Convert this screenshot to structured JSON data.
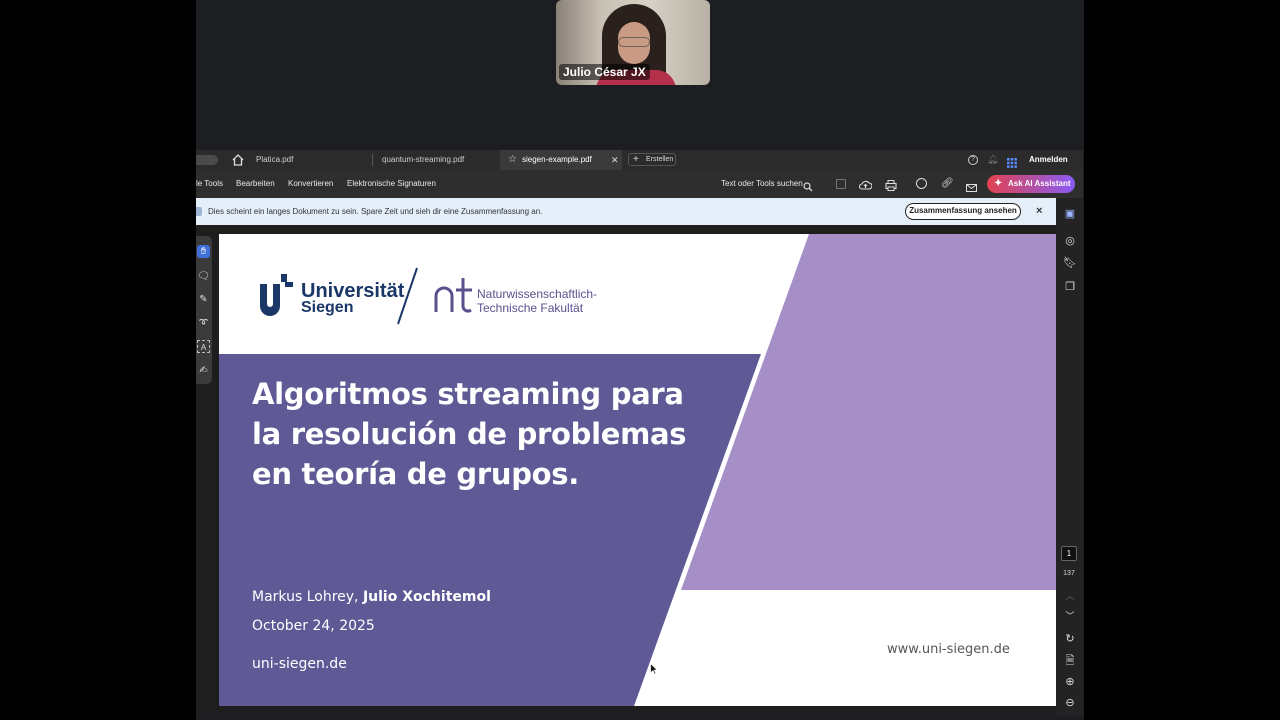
{
  "participant": {
    "name": "Julio César JX"
  },
  "tabs": [
    {
      "label": "Platica.pdf"
    },
    {
      "label": "quantum-streaming.pdf"
    },
    {
      "label": "siegen-example.pdf",
      "active": true
    }
  ],
  "tabbar": {
    "create_label": "Erstellen",
    "signin_label": "Anmelden"
  },
  "menu": {
    "items": [
      "le Tools",
      "Bearbeiten",
      "Konvertieren",
      "Elektronische Signaturen"
    ],
    "search_label": "Text oder Tools suchen",
    "ai_label": "Ask AI Assistant"
  },
  "notice": {
    "text": "Dies scheint ein langes Dokument zu sein. Spare Zeit und sieh dir eine Zusammenfassung an.",
    "button": "Zusammenfassung ansehen",
    "close": "×"
  },
  "slide": {
    "logo_uni_line1": "Universität",
    "logo_uni_line2": "Siegen",
    "logo_fak_line1": "Naturwissenschaftlich-",
    "logo_fak_line2": "Technische Fakultät",
    "title": "Algoritmos streaming para la resolución de problemas en teoría de grupos.",
    "author1": "Markus Lohrey, ",
    "author2": "Julio Xochitemol",
    "date": "October 24, 2025",
    "url_left": "uni-siegen.de",
    "url_right": "www.uni-siegen.de"
  },
  "pager": {
    "current": "1",
    "total": "137"
  },
  "colors": {
    "slide_purple": "#5f5a96",
    "slide_lilac": "#a68fc6",
    "accent_red": "#e0424f",
    "brand_blue": "#1b3767"
  }
}
